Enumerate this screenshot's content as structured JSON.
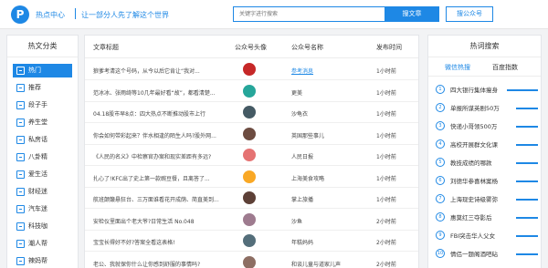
{
  "header": {
    "logo_letter": "P",
    "brand": "热点中心",
    "slogan": "让一部分人先了解这个世界",
    "search_placeholder": "关键字进行搜索",
    "search_button": "搜文章",
    "account_button": "搜公众号"
  },
  "sidebar": {
    "title": "热文分类",
    "items": [
      {
        "label": "热门",
        "active": true
      },
      {
        "label": "推荐"
      },
      {
        "label": "段子手"
      },
      {
        "label": "养生堂"
      },
      {
        "label": "私房话"
      },
      {
        "label": "八卦精"
      },
      {
        "label": "爱生活"
      },
      {
        "label": "财经迷"
      },
      {
        "label": "汽车迷"
      },
      {
        "label": "科技咖"
      },
      {
        "label": "潮人帮"
      },
      {
        "label": "辣妈帮"
      }
    ]
  },
  "table": {
    "headers": {
      "title": "文章标题",
      "avatar": "公众号头像",
      "account": "公众号名称",
      "time": "发布时间"
    },
    "rows": [
      {
        "title": "狼爹考清这个号码，从今以后它肯让“我对...",
        "account": "参考消息",
        "time": "1小时前",
        "avatar_color": "#c62828",
        "link": true
      },
      {
        "title": "范冰冰、张雨绮等10几年最好看“故”，都看清楚...",
        "account": "更美",
        "time": "1小时前",
        "avatar_color": "#26a69a"
      },
      {
        "title": "04.18股市早8点：四大热点不断推动股市上行",
        "account": "沙龟衣",
        "time": "1小时前",
        "avatar_color": "#455a64"
      },
      {
        "title": "你会如何带彩起来？伴水相逢的陌生人吗?股外网...",
        "account": "英国那些事儿",
        "time": "1小时前",
        "avatar_color": "#6d4c41"
      },
      {
        "title": "《人民的名义》中检察官办案和现实差距有多远?",
        "account": "人民日报",
        "time": "1小时前",
        "avatar_color": "#e57373"
      },
      {
        "title": "扎心了!KFC出了史上第一款豌豆餐，且离答了...",
        "account": "上海美食攻略",
        "time": "1小时前",
        "avatar_color": "#f9a825"
      },
      {
        "title": "航班颠簸悬狂台、三万面谁看花开成荫、简直美到...",
        "account": "掌上旅播",
        "time": "1小时前",
        "avatar_color": "#5d4037"
      },
      {
        "title": "安检仪里面出个老大爷?日常生活 No.048",
        "account": "沙鱼",
        "time": "2小时前",
        "avatar_color": "#9e7b8f"
      },
      {
        "title": "宝宝长得好不好?答案全看这表格!",
        "account": "年糕妈妈",
        "time": "2小时前",
        "avatar_color": "#546e7a"
      },
      {
        "title": "老公、我就保你什么让你感到舒服的事情吗?",
        "account": "和谈儿童与道家儿声",
        "time": "2小时前",
        "avatar_color": "#8d6e63"
      }
    ]
  },
  "hot": {
    "title": "热词搜索",
    "tab_weibo": "微信热搜",
    "tab_baidu": "百度指数",
    "items": [
      {
        "num": "1",
        "label": "四大银行集体瘦身",
        "bar": 0.3
      },
      {
        "num": "2",
        "label": "单报所谋英剧50万",
        "bar": 0.21
      },
      {
        "num": "3",
        "label": "快递小哥领500万",
        "bar": 0.21
      },
      {
        "num": "4",
        "label": "高校开展群文化课",
        "bar": 0.21
      },
      {
        "num": "5",
        "label": "教技成绩的哪款",
        "bar": 0.21
      },
      {
        "num": "6",
        "label": "刘德华参喜林案杨",
        "bar": 0.21
      },
      {
        "num": "7",
        "label": "上海现史诗级雾弥",
        "bar": 0.21
      },
      {
        "num": "8",
        "label": "惠莫红三夺影后",
        "bar": 0.21
      },
      {
        "num": "9",
        "label": "FBI突击华人父女",
        "bar": 0.21
      },
      {
        "num": "10",
        "label": "情侣一题阁酒吧砧",
        "bar": 0.21
      }
    ]
  },
  "colors": {
    "accent": "#1e88e5"
  }
}
